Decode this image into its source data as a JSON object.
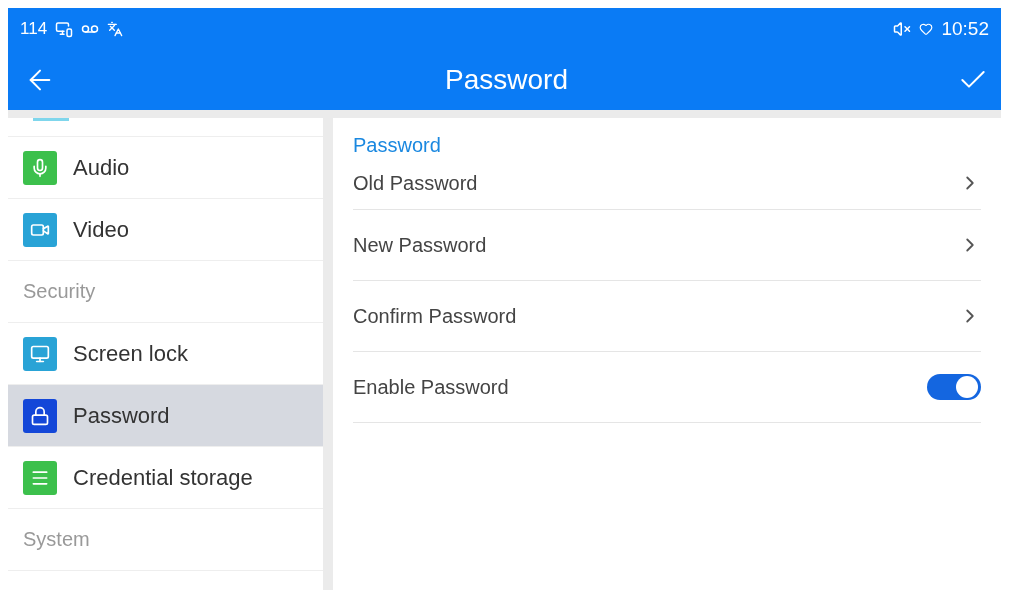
{
  "status_bar": {
    "extension": "114",
    "time": "10:52"
  },
  "title_bar": {
    "title": "Password"
  },
  "sidebar": {
    "items": [
      {
        "kind": "item",
        "label": "Audio",
        "color": "#3cc04c",
        "selected": false
      },
      {
        "kind": "item",
        "label": "Video",
        "color": "#29a3d6",
        "selected": false
      },
      {
        "kind": "header",
        "label": "Security"
      },
      {
        "kind": "item",
        "label": "Screen lock",
        "color": "#29a3d6",
        "selected": false
      },
      {
        "kind": "item",
        "label": "Password",
        "color": "#1447d8",
        "selected": true
      },
      {
        "kind": "item",
        "label": "Credential storage",
        "color": "#3cc04c",
        "selected": false
      },
      {
        "kind": "header",
        "label": "System"
      }
    ]
  },
  "panel": {
    "section": "Password",
    "rows": [
      {
        "kind": "link",
        "label": "Old Password"
      },
      {
        "kind": "link",
        "label": "New Password"
      },
      {
        "kind": "link",
        "label": "Confirm Password"
      },
      {
        "kind": "switch",
        "label": "Enable Password",
        "on": true
      }
    ]
  }
}
